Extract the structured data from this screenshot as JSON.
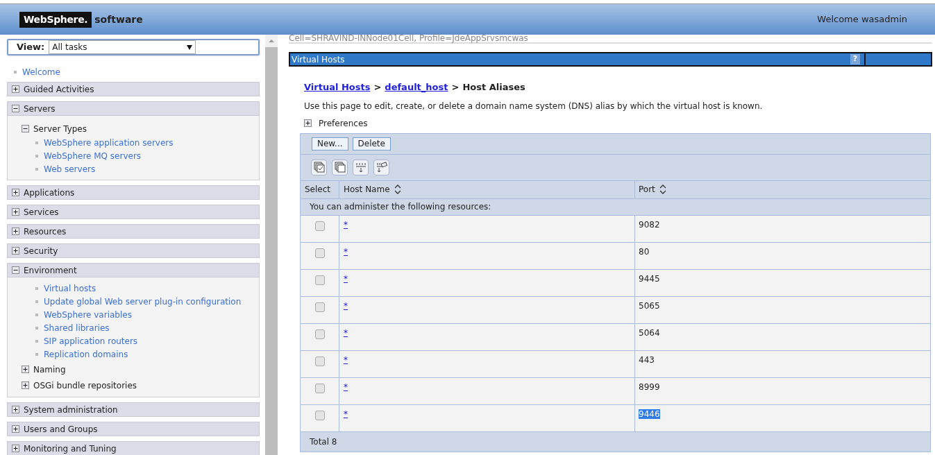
{
  "header": {
    "logo_mark": "WebSphere.",
    "logo_text": "software",
    "welcome": "Welcome wasadmin"
  },
  "sidebar": {
    "view_label": "View:",
    "view_value": "All tasks",
    "welcome_link": "Welcome",
    "sections": [
      {
        "label": "Guided Activities",
        "expanded": false
      },
      {
        "label": "Servers",
        "expanded": true,
        "children": [
          {
            "kind": "group",
            "label": "Server Types",
            "expanded": true,
            "children": [
              {
                "label": "WebSphere application servers"
              },
              {
                "label": "WebSphere MQ servers"
              },
              {
                "label": "Web servers"
              }
            ]
          }
        ]
      },
      {
        "label": "Applications",
        "expanded": false
      },
      {
        "label": "Services",
        "expanded": false
      },
      {
        "label": "Resources",
        "expanded": false
      },
      {
        "label": "Security",
        "expanded": false
      },
      {
        "label": "Environment",
        "expanded": true,
        "children": [
          {
            "kind": "link",
            "label": "Virtual hosts"
          },
          {
            "kind": "link",
            "label": "Update global Web server plug-in configuration"
          },
          {
            "kind": "link",
            "label": "WebSphere variables"
          },
          {
            "kind": "link",
            "label": "Shared libraries"
          },
          {
            "kind": "link",
            "label": "SIP application routers"
          },
          {
            "kind": "link",
            "label": "Replication domains"
          },
          {
            "kind": "group",
            "label": "Naming",
            "expanded": false
          },
          {
            "kind": "group",
            "label": "OSGi bundle repositories",
            "expanded": false
          }
        ]
      },
      {
        "label": "System administration",
        "expanded": false
      },
      {
        "label": "Users and Groups",
        "expanded": false
      },
      {
        "label": "Monitoring and Tuning",
        "expanded": false
      }
    ]
  },
  "scope": "Cell=SHRAVIND-INNode01Cell, Profile=JdeAppSrvsmcwas",
  "panel": {
    "title": "Virtual Hosts",
    "help": "?",
    "breadcrumb": [
      {
        "label": "Virtual Hosts",
        "link": true
      },
      {
        "label": "default_host",
        "link": true
      },
      {
        "label": "Host Aliases",
        "link": false
      }
    ],
    "separator": ">",
    "description": "Use this page to edit, create, or delete a domain name system (DNS) alias by which the virtual host is known.",
    "preferences": {
      "label": "Preferences",
      "expanded": false
    },
    "buttons": [
      "New...",
      "Delete"
    ],
    "table": {
      "columns": [
        "Select",
        "Host Name",
        "Port"
      ],
      "notice": "You can administer the following resources:",
      "rows": [
        {
          "checked": false,
          "host": "*",
          "port": "9082",
          "highlighted": false
        },
        {
          "checked": false,
          "host": "*",
          "port": "80",
          "highlighted": false
        },
        {
          "checked": false,
          "host": "*",
          "port": "9445",
          "highlighted": false
        },
        {
          "checked": false,
          "host": "*",
          "port": "5065",
          "highlighted": false
        },
        {
          "checked": false,
          "host": "*",
          "port": "5064",
          "highlighted": false
        },
        {
          "checked": false,
          "host": "*",
          "port": "443",
          "highlighted": false
        },
        {
          "checked": false,
          "host": "*",
          "port": "8999",
          "highlighted": false
        },
        {
          "checked": false,
          "host": "*",
          "port": "9446",
          "highlighted": true
        }
      ],
      "total": "Total 8"
    }
  }
}
